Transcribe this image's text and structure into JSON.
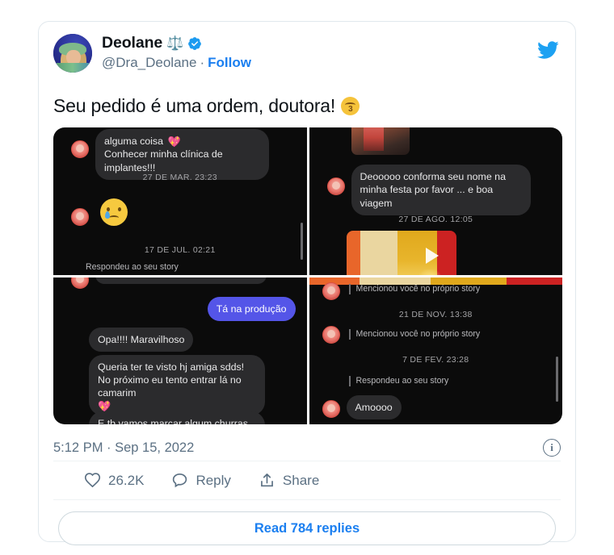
{
  "brand": {
    "twitter_blue": "#1DA1F2",
    "link_blue": "#1b7ff0",
    "text_dark": "#0f1419",
    "text_muted": "#5b7083",
    "bird_icon": "twitter-bird-icon",
    "verified_icon": "verified-badge-icon"
  },
  "author": {
    "display_name": "Deolane",
    "name_emoji": "⚖️",
    "handle": "@Dra_Deolane",
    "separator": "·",
    "follow_label": "Follow",
    "avatar_alt": "avatar"
  },
  "tweet": {
    "text": "Seu pedido é uma ordem, doutora!",
    "trailing_emoji": "kissing-face-emoji"
  },
  "media": {
    "quadrants": [
      {
        "position": "top-left",
        "messages": [
          {
            "type": "received-partial",
            "text": "alguma coisa"
          },
          {
            "type": "received",
            "text": "Conhecer minha clínica de implantes!!!"
          },
          {
            "type": "timestamp",
            "text": "27 DE MAR. 23:23"
          },
          {
            "type": "emoji",
            "text": "crying-face-emoji"
          },
          {
            "type": "timestamp",
            "text": "17 DE JUL. 02:21"
          },
          {
            "type": "system",
            "text": "Respondeu ao seu story"
          }
        ]
      },
      {
        "position": "top-right",
        "messages": [
          {
            "type": "photo",
            "text": "photo-attachment"
          },
          {
            "type": "received",
            "text": "Deooooo conforma seu nome na minha festa por favor ... e boa viagem"
          },
          {
            "type": "timestamp",
            "text": "27 DE AGO. 12:05"
          },
          {
            "type": "video",
            "text": "video-attachment"
          }
        ]
      },
      {
        "position": "bottom-left",
        "messages": [
          {
            "type": "received-partial",
            "text": ""
          },
          {
            "type": "sent",
            "text": "Tá na produção"
          },
          {
            "type": "received",
            "text": "Opa!!!! Maravilhoso"
          },
          {
            "type": "received",
            "text": "Queria ter te visto hj amiga sdds! No próximo eu tento entrar lá no camarim"
          },
          {
            "type": "received",
            "text": "E tb vamos marcar algum churras né!"
          }
        ]
      },
      {
        "position": "bottom-right",
        "messages": [
          {
            "type": "system",
            "text": "Mencionou você no próprio story"
          },
          {
            "type": "timestamp",
            "text": "21 DE NOV. 13:38"
          },
          {
            "type": "system",
            "text": "Mencionou você no próprio story"
          },
          {
            "type": "timestamp",
            "text": "7 DE FEV. 23:28"
          },
          {
            "type": "system",
            "text": "Respondeu ao seu story"
          },
          {
            "type": "received",
            "text": "Amoooo"
          }
        ]
      }
    ]
  },
  "footer": {
    "timestamp": "5:12 PM · Sep 15, 2022",
    "info_icon": "info-circle-icon"
  },
  "actions": {
    "like": {
      "icon": "heart-icon",
      "count": "26.2K"
    },
    "reply": {
      "icon": "comment-icon",
      "label": "Reply"
    },
    "share": {
      "icon": "share-icon",
      "label": "Share"
    }
  },
  "replies_button": {
    "label": "Read 784 replies"
  }
}
